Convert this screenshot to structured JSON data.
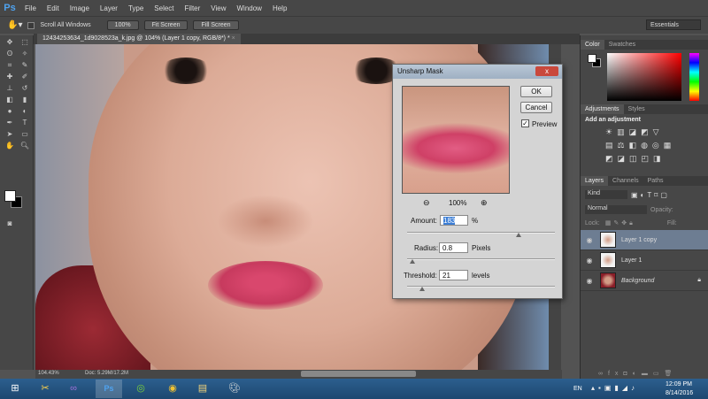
{
  "app": {
    "logo": "Ps"
  },
  "menu": [
    "File",
    "Edit",
    "Image",
    "Layer",
    "Type",
    "Select",
    "Filter",
    "View",
    "Window",
    "Help"
  ],
  "options": {
    "scroll_all": "Scroll All Windows",
    "zoom100": "100%",
    "fit_screen": "Fit Screen",
    "fill_screen": "Fill Screen",
    "workspace": "Essentials"
  },
  "document": {
    "tab_title": "12434253634_1d9028523a_k.jpg @ 104% (Layer 1 copy, RGB/8*) *",
    "close": "×"
  },
  "status": {
    "zoom": "104.43%",
    "doc": "Doc: 5.29M/17.2M"
  },
  "dialog": {
    "title": "Unsharp Mask",
    "close": "x",
    "ok": "OK",
    "cancel": "Cancel",
    "preview_label": "Preview",
    "preview_checked": true,
    "preview_zoom": "100%",
    "amount": {
      "label": "Amount:",
      "value": "183",
      "unit": "%",
      "slider_percent": 74
    },
    "radius": {
      "label": "Radius:",
      "value": "0.8",
      "unit": "Pixels",
      "slider_percent": 2
    },
    "threshold": {
      "label": "Threshold:",
      "value": "21",
      "unit": "levels",
      "slider_percent": 8
    }
  },
  "panels": {
    "color_tabs": [
      "Color",
      "Swatches"
    ],
    "adjust_tabs": [
      "Adjustments",
      "Styles"
    ],
    "add_adjustment": "Add an adjustment",
    "layers_tabs": [
      "Layers",
      "Channels",
      "Paths"
    ],
    "kind": "Kind",
    "blend": "Normal",
    "opacity_label": "Opacity:",
    "lock_label": "Lock:",
    "fill_label": "Fill:",
    "layers": [
      {
        "name": "Layer 1 copy",
        "selected": true
      },
      {
        "name": "Layer 1",
        "selected": false
      },
      {
        "name": "Background",
        "selected": false,
        "locked": true
      }
    ]
  },
  "taskbar": {
    "lang": "EN",
    "time": "12:09 PM",
    "date": "8/14/2016"
  },
  "colors": {
    "accent": "#6d7d92",
    "dialog_title": "#b9c7d6",
    "close_red": "#c9483c"
  }
}
